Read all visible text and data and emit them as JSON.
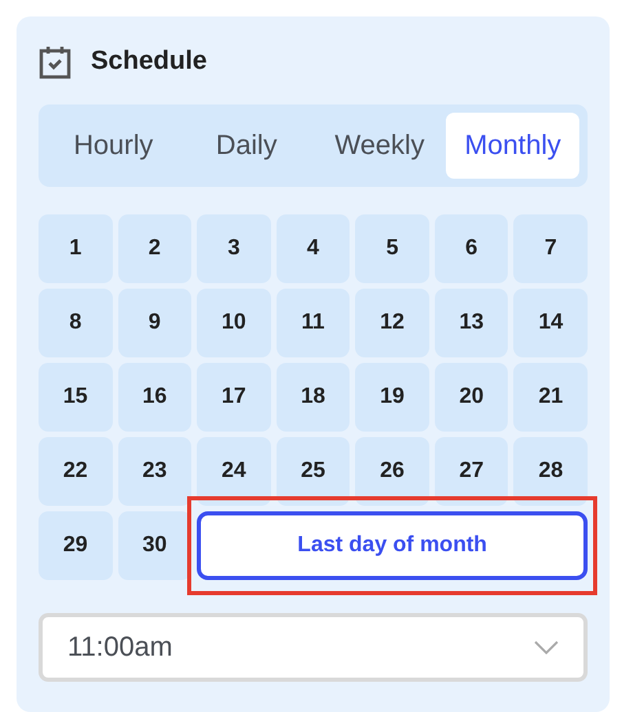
{
  "title": "Schedule",
  "tabs": [
    {
      "label": "Hourly",
      "selected": false
    },
    {
      "label": "Daily",
      "selected": false
    },
    {
      "label": "Weekly",
      "selected": false
    },
    {
      "label": "Monthly",
      "selected": true
    }
  ],
  "days": [
    {
      "label": "1",
      "selected": false
    },
    {
      "label": "2",
      "selected": false
    },
    {
      "label": "3",
      "selected": false
    },
    {
      "label": "4",
      "selected": false
    },
    {
      "label": "5",
      "selected": false
    },
    {
      "label": "6",
      "selected": false
    },
    {
      "label": "7",
      "selected": false
    },
    {
      "label": "8",
      "selected": false
    },
    {
      "label": "9",
      "selected": false
    },
    {
      "label": "10",
      "selected": false
    },
    {
      "label": "11",
      "selected": false
    },
    {
      "label": "12",
      "selected": false
    },
    {
      "label": "13",
      "selected": false
    },
    {
      "label": "14",
      "selected": false
    },
    {
      "label": "15",
      "selected": false
    },
    {
      "label": "16",
      "selected": false
    },
    {
      "label": "17",
      "selected": false
    },
    {
      "label": "18",
      "selected": false
    },
    {
      "label": "19",
      "selected": false
    },
    {
      "label": "20",
      "selected": false
    },
    {
      "label": "21",
      "selected": false
    },
    {
      "label": "22",
      "selected": false
    },
    {
      "label": "23",
      "selected": false
    },
    {
      "label": "24",
      "selected": false
    },
    {
      "label": "25",
      "selected": false
    },
    {
      "label": "26",
      "selected": false
    },
    {
      "label": "27",
      "selected": false
    },
    {
      "label": "28",
      "selected": false
    },
    {
      "label": "29",
      "selected": false
    },
    {
      "label": "30",
      "selected": false
    }
  ],
  "last_day": {
    "label": "Last day of month",
    "selected": true,
    "highlighted": true
  },
  "time": {
    "value": "11:00am"
  }
}
